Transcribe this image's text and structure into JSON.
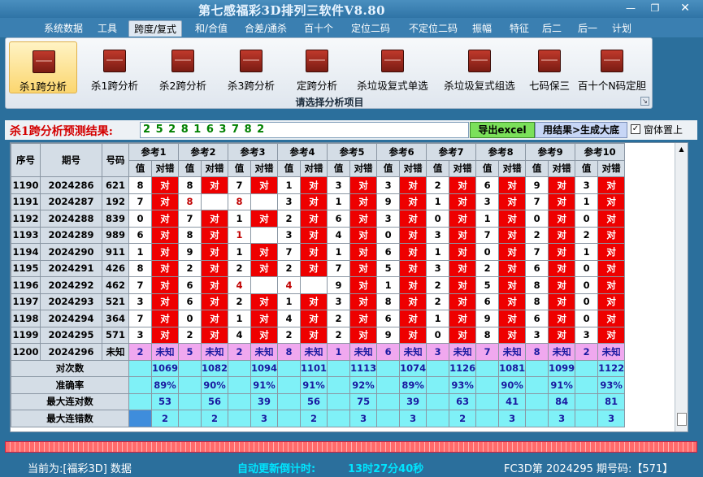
{
  "window": {
    "title": "第七感福彩3D排列三软件V8.80",
    "min": "—",
    "max": "❐",
    "close": "✕"
  },
  "menu": [
    "系统数据",
    "工具",
    "跨度/复式",
    "和/合值",
    "合差/通杀",
    "百十个",
    "定位二码",
    "不定位二码",
    "振幅",
    "特征",
    "后二",
    "后一",
    "计划"
  ],
  "ribbon": {
    "buttons": [
      "杀1跨分析",
      "杀1跨分析",
      "杀2跨分析",
      "杀3跨分析",
      "定跨分析",
      "杀垃圾复式单选",
      "杀垃圾复式组选",
      "七码保三",
      "百十个N码定胆"
    ],
    "group_label": "请选择分析项目",
    "launcher": "↘"
  },
  "result": {
    "label": "杀1跨分析预测结果:",
    "value": "2 5 2 8 1 6 3 7 8 2",
    "export": "导出excel",
    "generate": "用结果>生成大底",
    "checkbox": "✓",
    "checkbox_label": "窗体置上"
  },
  "grid": {
    "headers": {
      "seq": "序号",
      "period": "期号",
      "number": "号码",
      "value": "值",
      "judge": "对错"
    },
    "refs": [
      "参考1",
      "参考2",
      "参考3",
      "参考4",
      "参考5",
      "参考6",
      "参考7",
      "参考8",
      "参考9",
      "参考10"
    ],
    "rows": [
      {
        "seq": "1190",
        "period": "2024286",
        "num": "621",
        "cells": [
          [
            "8",
            "对"
          ],
          [
            "8",
            "对"
          ],
          [
            "7",
            "对"
          ],
          [
            "1",
            "对"
          ],
          [
            "3",
            "对"
          ],
          [
            "3",
            "对"
          ],
          [
            "2",
            "对"
          ],
          [
            "6",
            "对"
          ],
          [
            "9",
            "对"
          ],
          [
            "3",
            "对"
          ]
        ]
      },
      {
        "seq": "1191",
        "period": "2024287",
        "num": "192",
        "cells": [
          [
            "7",
            "对"
          ],
          [
            "8",
            ""
          ],
          [
            "8",
            ""
          ],
          [
            "3",
            "对"
          ],
          [
            "1",
            "对"
          ],
          [
            "9",
            "对"
          ],
          [
            "1",
            "对"
          ],
          [
            "3",
            "对"
          ],
          [
            "7",
            "对"
          ],
          [
            "1",
            "对"
          ]
        ]
      },
      {
        "seq": "1192",
        "period": "2024288",
        "num": "839",
        "cells": [
          [
            "0",
            "对"
          ],
          [
            "7",
            "对"
          ],
          [
            "1",
            "对"
          ],
          [
            "2",
            "对"
          ],
          [
            "6",
            "对"
          ],
          [
            "3",
            "对"
          ],
          [
            "0",
            "对"
          ],
          [
            "1",
            "对"
          ],
          [
            "0",
            "对"
          ],
          [
            "0",
            "对"
          ]
        ]
      },
      {
        "seq": "1193",
        "period": "2024289",
        "num": "989",
        "cells": [
          [
            "6",
            "对"
          ],
          [
            "8",
            "对"
          ],
          [
            "1",
            ""
          ],
          [
            "3",
            "对"
          ],
          [
            "4",
            "对"
          ],
          [
            "0",
            "对"
          ],
          [
            "3",
            "对"
          ],
          [
            "7",
            "对"
          ],
          [
            "2",
            "对"
          ],
          [
            "2",
            "对"
          ]
        ]
      },
      {
        "seq": "1194",
        "period": "2024290",
        "num": "911",
        "cells": [
          [
            "1",
            "对"
          ],
          [
            "9",
            "对"
          ],
          [
            "1",
            "对"
          ],
          [
            "7",
            "对"
          ],
          [
            "1",
            "对"
          ],
          [
            "6",
            "对"
          ],
          [
            "1",
            "对"
          ],
          [
            "0",
            "对"
          ],
          [
            "7",
            "对"
          ],
          [
            "1",
            "对"
          ]
        ]
      },
      {
        "seq": "1195",
        "period": "2024291",
        "num": "426",
        "cells": [
          [
            "8",
            "对"
          ],
          [
            "2",
            "对"
          ],
          [
            "2",
            "对"
          ],
          [
            "2",
            "对"
          ],
          [
            "7",
            "对"
          ],
          [
            "5",
            "对"
          ],
          [
            "3",
            "对"
          ],
          [
            "2",
            "对"
          ],
          [
            "6",
            "对"
          ],
          [
            "0",
            "对"
          ]
        ]
      },
      {
        "seq": "1196",
        "period": "2024292",
        "num": "462",
        "cells": [
          [
            "7",
            "对"
          ],
          [
            "6",
            "对"
          ],
          [
            "4",
            ""
          ],
          [
            "4",
            ""
          ],
          [
            "9",
            "对"
          ],
          [
            "1",
            "对"
          ],
          [
            "2",
            "对"
          ],
          [
            "5",
            "对"
          ],
          [
            "8",
            "对"
          ],
          [
            "0",
            "对"
          ]
        ]
      },
      {
        "seq": "1197",
        "period": "2024293",
        "num": "521",
        "cells": [
          [
            "3",
            "对"
          ],
          [
            "6",
            "对"
          ],
          [
            "2",
            "对"
          ],
          [
            "1",
            "对"
          ],
          [
            "3",
            "对"
          ],
          [
            "8",
            "对"
          ],
          [
            "2",
            "对"
          ],
          [
            "6",
            "对"
          ],
          [
            "8",
            "对"
          ],
          [
            "0",
            "对"
          ]
        ]
      },
      {
        "seq": "1198",
        "period": "2024294",
        "num": "364",
        "cells": [
          [
            "7",
            "对"
          ],
          [
            "0",
            "对"
          ],
          [
            "1",
            "对"
          ],
          [
            "4",
            "对"
          ],
          [
            "2",
            "对"
          ],
          [
            "6",
            "对"
          ],
          [
            "1",
            "对"
          ],
          [
            "9",
            "对"
          ],
          [
            "6",
            "对"
          ],
          [
            "0",
            "对"
          ]
        ]
      },
      {
        "seq": "1199",
        "period": "2024295",
        "num": "571",
        "cells": [
          [
            "3",
            "对"
          ],
          [
            "2",
            "对"
          ],
          [
            "4",
            "对"
          ],
          [
            "2",
            "对"
          ],
          [
            "2",
            "对"
          ],
          [
            "9",
            "对"
          ],
          [
            "0",
            "对"
          ],
          [
            "8",
            "对"
          ],
          [
            "3",
            "对"
          ],
          [
            "3",
            "对"
          ]
        ]
      },
      {
        "seq": "1200",
        "period": "2024296",
        "num": "未知",
        "cells": [
          [
            "2",
            "未知"
          ],
          [
            "5",
            "未知"
          ],
          [
            "2",
            "未知"
          ],
          [
            "8",
            "未知"
          ],
          [
            "1",
            "未知"
          ],
          [
            "6",
            "未知"
          ],
          [
            "3",
            "未知"
          ],
          [
            "7",
            "未知"
          ],
          [
            "8",
            "未知"
          ],
          [
            "2",
            "未知"
          ]
        ]
      }
    ],
    "stats": [
      {
        "label": "对次数",
        "values": [
          "1069",
          "1082",
          "1094",
          "1101",
          "1113",
          "1074",
          "1126",
          "1081",
          "1099",
          "1122"
        ]
      },
      {
        "label": "准确率",
        "values": [
          "89%",
          "90%",
          "91%",
          "91%",
          "92%",
          "89%",
          "93%",
          "90%",
          "91%",
          "93%"
        ]
      },
      {
        "label": "最大连对数",
        "values": [
          "53",
          "56",
          "39",
          "56",
          "75",
          "39",
          "63",
          "41",
          "84",
          "81"
        ]
      },
      {
        "label": "最大连错数",
        "values": [
          "2",
          "2",
          "3",
          "2",
          "3",
          "3",
          "2",
          "3",
          "3",
          "3"
        ]
      }
    ]
  },
  "status": {
    "current": "当前为:[福彩3D] 数据",
    "countdown_label": "自动更新倒计时:",
    "countdown": "13时27分40秒",
    "issue": "FC3D第 2024295 期号码:【571】"
  },
  "colors": {
    "hit": "#ee0000",
    "unknown": "#f0a8ef",
    "stat": "#7ff1f7",
    "header": "#d4dde6",
    "chrome": "#2b6f9c"
  }
}
